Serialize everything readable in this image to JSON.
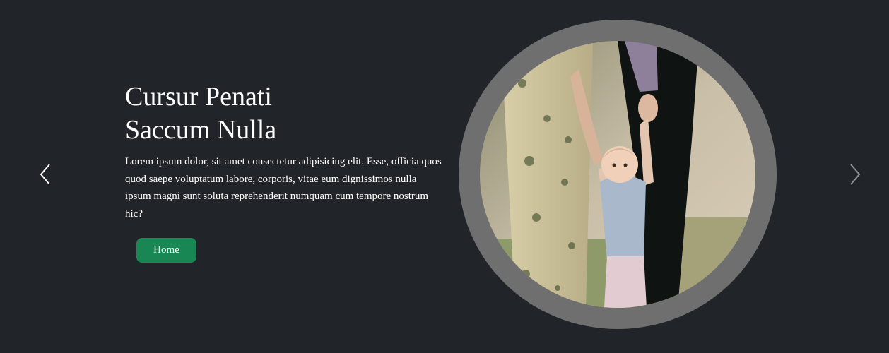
{
  "slide": {
    "title_line1": "Cursur Penati",
    "title_line2": "Saccum Nulla",
    "description": "Lorem ipsum dolor, sit amet consectetur adipisicing elit. Esse, officia quos quod saepe voluptatum labore, corporis, vitae eum dignissimos nulla ipsum magni sunt soluta reprehenderit numquam cum tempore nostrum hic?",
    "button_label": "Home"
  },
  "controls": {
    "prev_icon": "chevron-left-icon",
    "next_icon": "chevron-right-icon"
  },
  "image": {
    "subject": "toddler walking while holding parents' hands"
  },
  "colors": {
    "background": "#212429",
    "button": "#198754",
    "frame": "#6f6f6f",
    "text": "#ffffff"
  }
}
